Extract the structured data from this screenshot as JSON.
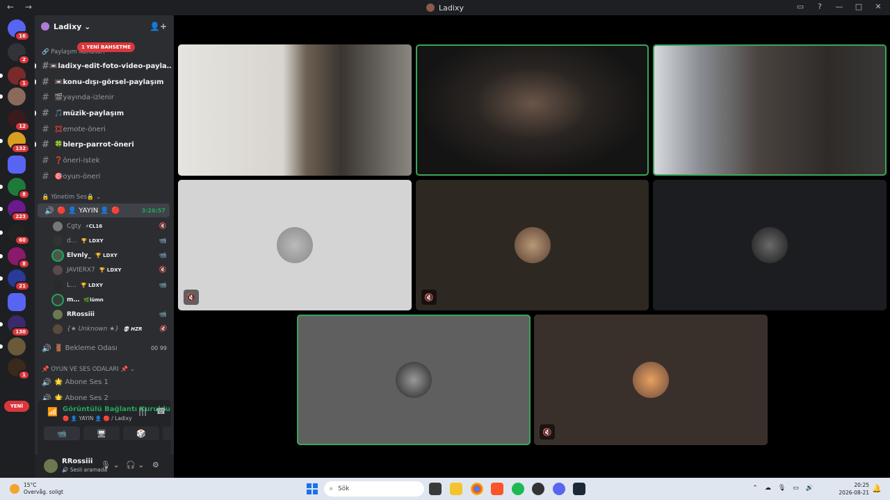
{
  "window": {
    "title": "Ladixy",
    "nav_arrows": "← →"
  },
  "servers": {
    "badges": [
      "16",
      "2",
      "1",
      "12",
      "132",
      "8",
      "223",
      "60",
      "8",
      "21",
      "130",
      "1"
    ],
    "new_label": "YENİ"
  },
  "guild": {
    "name": "Ladixy ⌄",
    "mention_pill": "1 YENİ BAHSETME"
  },
  "categories": {
    "share": "🔗 Paylaşım Kanalları",
    "voice_admin": "🔒 Yönetim Ses🔒 ⌄",
    "games": "📌 OYUN VE SES ODALARI 📌 ⌄"
  },
  "text_channels": [
    {
      "name": "📼ladixy-edit-foto-video-payla…",
      "unread": true
    },
    {
      "name": "📼konu-dışı-görsel-paylaşım",
      "unread": true
    },
    {
      "name": "🎬yayında-izlenir",
      "unread": false
    },
    {
      "name": "🎵müzik-paylaşım",
      "unread": true
    },
    {
      "name": "💢emote-öneri",
      "unread": false
    },
    {
      "name": "🍀blerp-parrot-öneri",
      "unread": true
    },
    {
      "name": "❓öneri-istek",
      "unread": false
    },
    {
      "name": "🎯oyun-öneri",
      "unread": false
    }
  ],
  "active_voice": {
    "name": "🔴 👤 YAYIN 👤 🔴",
    "timer": "3:26:57"
  },
  "voice_members": [
    {
      "name": "Cgty",
      "tag": "⚡CL16",
      "icon": "🔇"
    },
    {
      "name": "d…",
      "tag": "🏆 LDXY",
      "icon": "📹"
    },
    {
      "name": "Elvnly_",
      "tag": "🏆 LDXY",
      "icon": "📹"
    },
    {
      "name": "JAVIERX7",
      "tag": "🏆 LDXY",
      "icon": "🔇"
    },
    {
      "name": "L…",
      "tag": "🏆 LDXY",
      "icon": "📹"
    },
    {
      "name": "m…",
      "tag": "🌿lümn",
      "icon": ""
    },
    {
      "name": "RRossiii",
      "tag": "",
      "icon": "📹"
    },
    {
      "name": "{★ Unknown ★}",
      "tag": "💀 HZR",
      "icon": "🔇"
    }
  ],
  "other_voice": [
    {
      "name": "🚪 Bekleme Odası",
      "counts": "00  99"
    },
    {
      "name": "🌟 Abone Ses 1",
      "counts": ""
    },
    {
      "name": "🌟 Abone Ses 2",
      "counts": ""
    }
  ],
  "voice_connection": {
    "status": "Görüntülü Bağlantı Kuruldu",
    "channel": "🔴 👤 YAYIN 👤 🔴 / Ladixy",
    "signal_icon": "📶",
    "buttons": [
      "📹",
      "🖥",
      "🎲",
      "✨"
    ]
  },
  "user": {
    "name": "RRossiii",
    "status": "🔊 Sesli aramada",
    "icons": [
      "🎙 ⌄",
      "🎧 ⌄",
      "⚙"
    ]
  },
  "tiles_mute_glyph": "🔇",
  "taskbar": {
    "temp": "15°C",
    "weather": "Overvåg. soligt",
    "search": "Sök",
    "time": "20:25",
    "date": "2026-08-21"
  }
}
